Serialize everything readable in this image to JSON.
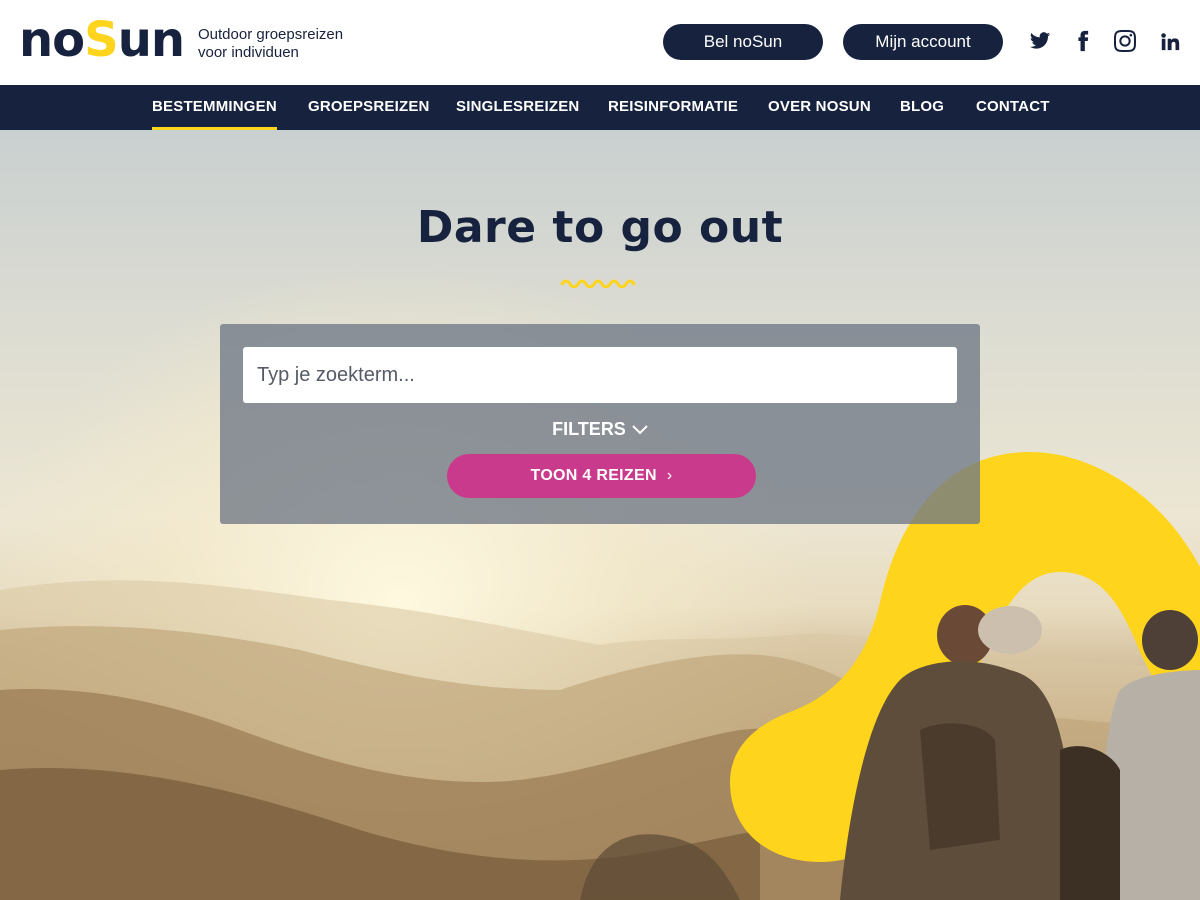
{
  "brand": {
    "logo_prefix": "no",
    "logo_s": "S",
    "logo_suffix": "un",
    "tagline_line1": "Outdoor groepsreizen",
    "tagline_line2": "voor individuen"
  },
  "header": {
    "call_button": "Bel noSun",
    "account_button": "Mijn account",
    "social_icons": [
      "twitter-icon",
      "facebook-icon",
      "instagram-icon",
      "linkedin-icon"
    ]
  },
  "nav": {
    "items": [
      {
        "label": "BESTEMMINGEN",
        "active": true
      },
      {
        "label": "GROEPSREIZEN",
        "active": false
      },
      {
        "label": "SINGLESREIZEN",
        "active": false
      },
      {
        "label": "REISINFORMATIE",
        "active": false
      },
      {
        "label": "OVER NOSUN",
        "active": false
      },
      {
        "label": "BLOG",
        "active": false
      },
      {
        "label": "CONTACT",
        "active": false
      }
    ]
  },
  "hero": {
    "title": "Dare to go out",
    "search_placeholder": "Typ je zoekterm...",
    "filters_label": "FILTERS",
    "show_button": "TOON 4 REIZEN"
  },
  "colors": {
    "navy": "#17223e",
    "yellow": "#ffd41c",
    "magenta": "#c93a8c"
  }
}
